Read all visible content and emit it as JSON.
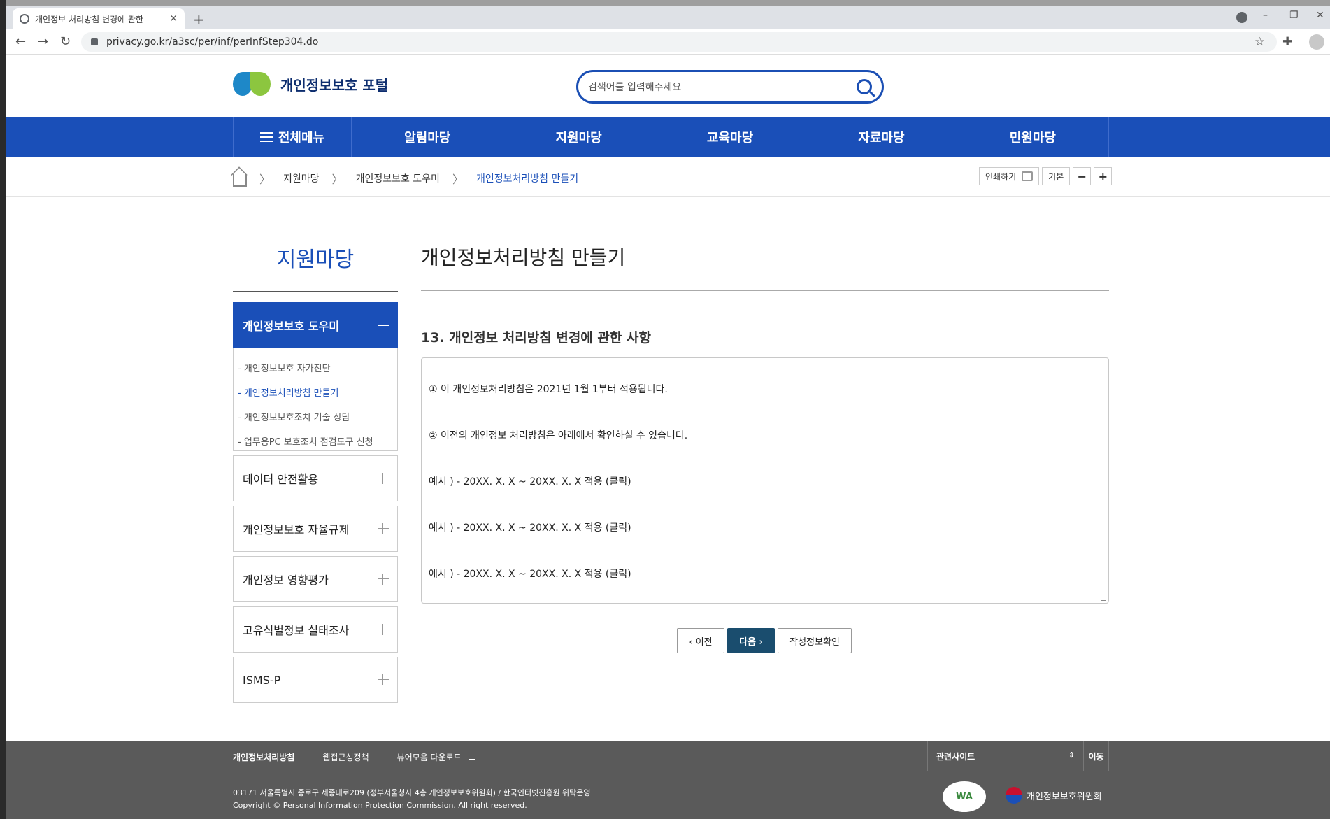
{
  "browser": {
    "tab_title": "개인정보 처리방침 변경에 관한",
    "url": "privacy.go.kr/a3sc/per/inf/perInfStep304.do"
  },
  "header": {
    "logo_text": "개인정보보호 포털",
    "search_placeholder": "검색어를 입력해주세요"
  },
  "gnb": {
    "all_menu": "전체메뉴",
    "items": [
      "알림마당",
      "지원마당",
      "교육마당",
      "자료마당",
      "민원마당"
    ]
  },
  "breadcrumb": {
    "items": [
      "지원마당",
      "개인정보보호 도우미",
      "개인정보처리방침 만들기"
    ],
    "tools": {
      "print": "인쇄하기",
      "default": "기본",
      "minus": "−",
      "plus": "+"
    }
  },
  "sidebar": {
    "title": "지원마당",
    "active": "개인정보보호 도우미",
    "sub_items": [
      "- 개인정보보호 자가진단",
      "- 개인정보처리방침 만들기",
      "- 개인정보보호조치 기술 상담",
      "- 업무용PC 보호조치 점검도구 신청"
    ],
    "items": [
      "데이터 안전활용",
      "개인정보보호 자율규제",
      "개인정보 영향평가",
      "고유식별정보 실태조사",
      "ISMS-P"
    ]
  },
  "main": {
    "page_title": "개인정보처리방침 만들기",
    "section_title": "13. 개인정보 처리방침 변경에 관한 사항",
    "lines": [
      "① 이 개인정보처리방침은 2021년 1월 1부터 적용됩니다.",
      "② 이전의 개인정보 처리방침은 아래에서 확인하실 수 있습니다.",
      "예시 ) - 20XX. X. X ~ 20XX. X. X 적용  (클릭)",
      "예시 ) - 20XX. X. X ~ 20XX. X. X 적용  (클릭)",
      "예시 ) - 20XX. X. X ~ 20XX. X. X 적용  (클릭)"
    ],
    "buttons": {
      "prev": "‹  이전",
      "next": "다음  ›",
      "check": "작성정보확인"
    }
  },
  "footer": {
    "links": [
      "개인정보처리방침",
      "웹접근성정책",
      "뷰어모음 다운로드"
    ],
    "related": "관련사이트",
    "related_arrows": "⇕",
    "go": "이동",
    "address": "03171 서울특별시 종로구 세종대로209 (정부서울청사 4층 개인정보보호위원회) / 한국인터넷진흥원 위탁운영",
    "copyright": "Copyright © Personal Information Protection Commission. All right reserved.",
    "wa_mark": "WA",
    "org_name": "개인정보보호위원회"
  }
}
